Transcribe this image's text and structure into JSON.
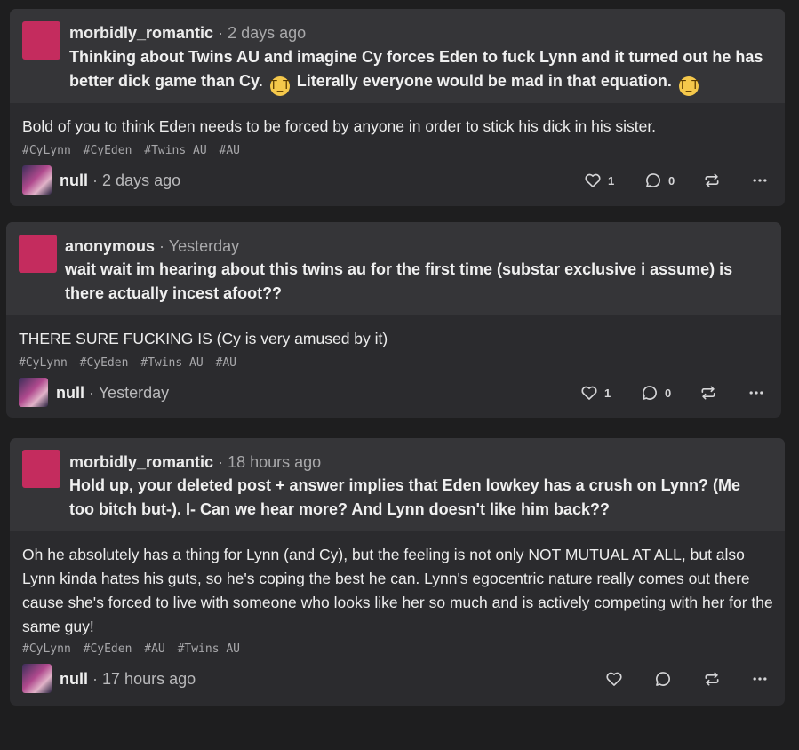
{
  "posts": [
    {
      "asker": "morbidly_romantic",
      "separator": "·",
      "ask_time": "2 days ago",
      "question_line1": "Thinking about Twins AU and imagine Cy forces Eden to fuck Lynn and it turned out he has",
      "question_line2_a": "better dick game than Cy.",
      "question_line2_b": "Literally everyone would be mad in that equation.",
      "emoji": "😭",
      "answer": "Bold of you to think Eden needs to be forced by anyone in order to stick his dick in his sister.",
      "tags": [
        "#CyLynn",
        "#CyEden",
        "#Twins AU",
        "#AU"
      ],
      "user": "null",
      "user_time": "2 days ago",
      "likes": "1",
      "comments": "0"
    },
    {
      "asker": "anonymous",
      "separator": "·",
      "ask_time": "Yesterday",
      "question": "wait wait im hearing about this twins au for the first time (substar exclusive i assume) is there actually incest afoot??",
      "answer": "THERE SURE FUCKING IS (Cy is very amused by it)",
      "tags": [
        "#CyLynn",
        "#CyEden",
        "#Twins AU",
        "#AU"
      ],
      "user": "null",
      "user_time": "Yesterday",
      "likes": "1",
      "comments": "0"
    },
    {
      "asker": "morbidly_romantic",
      "separator": "·",
      "ask_time": "18 hours ago",
      "question": "Hold up, your deleted post + answer implies that Eden lowkey has a crush on Lynn? (Me too bitch but-). I- Can we hear more? And Lynn doesn't like him back??",
      "answer": "Oh he absolutely has a thing for Lynn (and Cy), but the feeling is not only NOT MUTUAL AT ALL, but also Lynn kinda hates his guts, so he's coping the best he can. Lynn's egocentric nature really comes out there cause she's forced to live with someone who looks like her so much and is actively competing with her for the same guy!",
      "tags": [
        "#CyLynn",
        "#CyEden",
        "#AU",
        "#Twins AU"
      ],
      "user": "null",
      "user_time": "17 hours ago",
      "likes": "",
      "comments": ""
    }
  ],
  "icons": {
    "like": "heart-icon",
    "comment": "comment-icon",
    "reblog": "reblog-icon",
    "more": "more-icon"
  },
  "colors": {
    "background": "#1e1e1f",
    "card": "#2b2b2e",
    "ask_panel": "#353538",
    "asker_avatar": "#c42c5e",
    "tag_text": "#a7a7aa"
  }
}
